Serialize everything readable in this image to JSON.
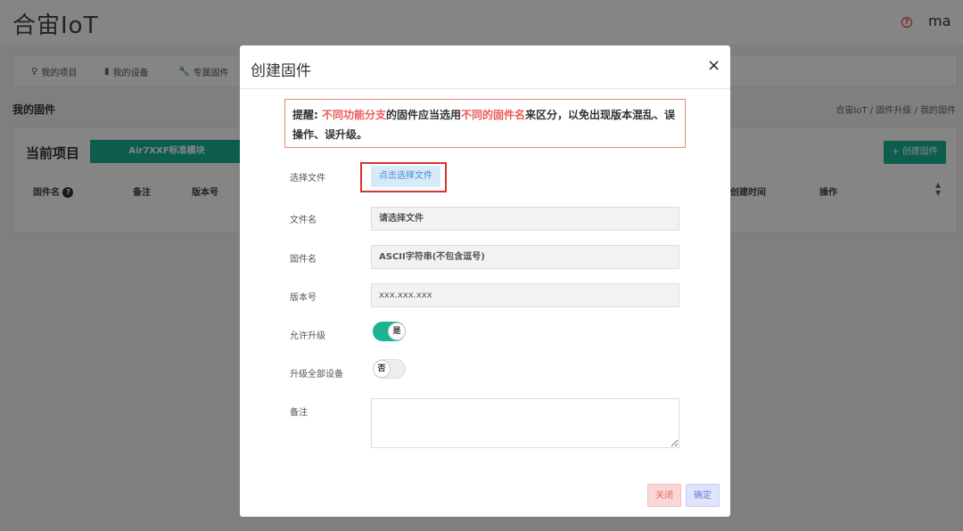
{
  "app": {
    "title": "合宙IoT",
    "user": "ma",
    "help_icon": "?"
  },
  "nav": {
    "items": [
      {
        "label": "我的项目",
        "icon": "lightbulb-icon",
        "glyph": "♀"
      },
      {
        "label": "我的设备",
        "icon": "chip-icon",
        "glyph": "▮"
      },
      {
        "label": "专属固件",
        "icon": "wrench-icon",
        "glyph": "🔧"
      }
    ]
  },
  "page": {
    "heading": "我的固件",
    "breadcrumb": "合宙IoT / 固件升级 / 我的固件"
  },
  "panel": {
    "title": "当前项目",
    "project": "Air7XXF标准模块",
    "create_button": "+ 创建固件",
    "columns": [
      "固件名",
      "备注",
      "版本号",
      "创建时间",
      "操作"
    ]
  },
  "modal": {
    "title": "创建固件",
    "close_glyph": "×",
    "warning": {
      "prefix": "提醒: ",
      "part1": "不同功能分支",
      "mid1": "的固件应当选用",
      "part2": "不同的固件名",
      "rest": "来区分，以免出现版本混乱、误操作、误升级。"
    },
    "fields": {
      "file_label": "选择文件",
      "file_button": "点击选择文件",
      "filename_label": "文件名",
      "filename_value": "请选择文件",
      "firmware_label": "固件名",
      "firmware_placeholder": "ASCII字符串(不包含逗号)",
      "version_label": "版本号",
      "version_placeholder": "xxx.xxx.xxx",
      "allow_upgrade_label": "允许升级",
      "allow_upgrade_state": "是",
      "upgrade_all_label": "升级全部设备",
      "upgrade_all_state": "否",
      "remark_label": "备注"
    },
    "footer": {
      "close": "关闭",
      "confirm": "确定"
    }
  },
  "colors": {
    "accent": "#1ab394",
    "warning_red": "#ec5a59",
    "highlight_border": "#d9332c"
  }
}
